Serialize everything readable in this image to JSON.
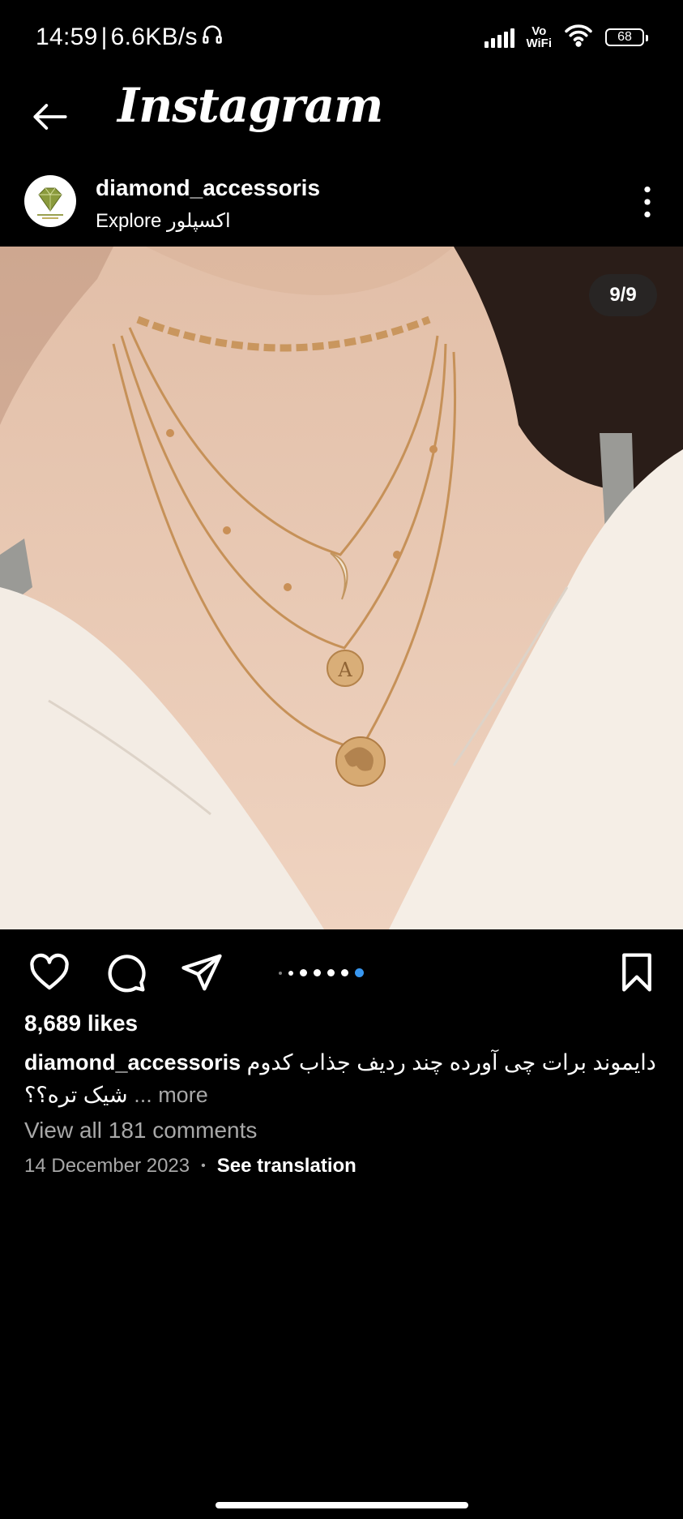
{
  "status": {
    "time": "14:59",
    "speed": "6.6KB/s",
    "network_label": "Vo\nWiFi",
    "battery": "68"
  },
  "app_bar": {
    "logo_text": "Instagram"
  },
  "post": {
    "username": "diamond_accessoris",
    "location": "Explore اکسپلور",
    "image_counter": "9/9",
    "likes": "8,689 likes",
    "caption_user": "diamond_accessoris",
    "caption_text": "دایموند برات چی آورده چند ردیف جذاب کدوم شیک تره؟؟",
    "caption_more": "... more",
    "view_comments": "View all 181 comments",
    "date": "14 December 2023",
    "separator": "•",
    "see_translation": "See translation"
  },
  "icons": {
    "back": "arrow-left-icon",
    "more": "more-vertical-icon",
    "like": "heart-icon",
    "comment": "comment-icon",
    "share": "send-icon",
    "save": "bookmark-icon"
  },
  "carousel": {
    "total": 9,
    "current": 9
  },
  "colors": {
    "background": "#000000",
    "accent_dot": "#3897f0",
    "secondary_text": "#a8a8a8"
  }
}
